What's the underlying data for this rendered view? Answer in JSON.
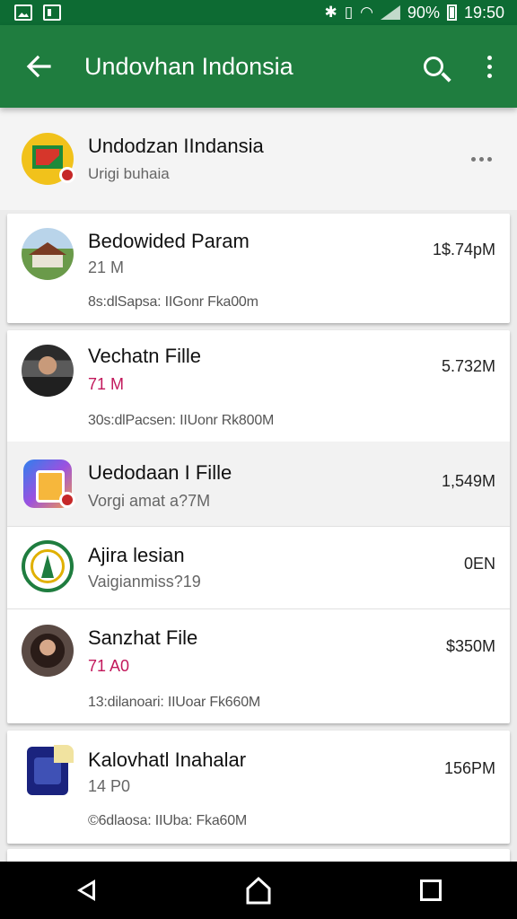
{
  "status_bar": {
    "battery": "90%",
    "time": "19:50",
    "icons": [
      "image-icon",
      "gallery-icon",
      "bluetooth-icon",
      "vibrate-icon",
      "wifi-icon",
      "signal-icon",
      "battery-icon"
    ]
  },
  "app_bar": {
    "title": "Undovhan Indonsia",
    "actions": [
      "back-icon",
      "search-icon",
      "overflow-menu-icon"
    ]
  },
  "header": {
    "title": "Undodzan IIndansia",
    "subtitle": "Urigi buhaia"
  },
  "items": [
    {
      "name": "Bedowided Param",
      "meta": "21 M",
      "desc": "8s:dlSapsa: IIGonr Fka00m",
      "size": "1$.74pM"
    },
    {
      "name": "Vechatn Fille",
      "meta": "71 M",
      "desc": "30s:dlPacsen: IIUonr Rk800M",
      "size": "5.732M"
    },
    {
      "name": "Uedodaan I Fille",
      "meta": "Vorgi amat a?7M",
      "desc": "",
      "size": "1,549M"
    },
    {
      "name": "Ajira lesian",
      "meta": "Vaigianmiss?19",
      "desc": "",
      "size": "0EN"
    },
    {
      "name": "Sanzhat File",
      "meta": "71 A0",
      "desc": "13:dilanoari: IIUoar Fk660M",
      "size": "$350M"
    },
    {
      "name": "Kalovhatl Inahalar",
      "meta": "14 P0",
      "desc": "©6dlaosa: IIUba: Fka60M",
      "size": "156PM"
    }
  ],
  "nav_bar": [
    "nav-back-icon",
    "nav-home-icon",
    "nav-recents-icon"
  ],
  "colors": {
    "status_bar": "#0d6b33",
    "app_bar": "#1f7d3f",
    "accent_red": "#c2185b"
  }
}
